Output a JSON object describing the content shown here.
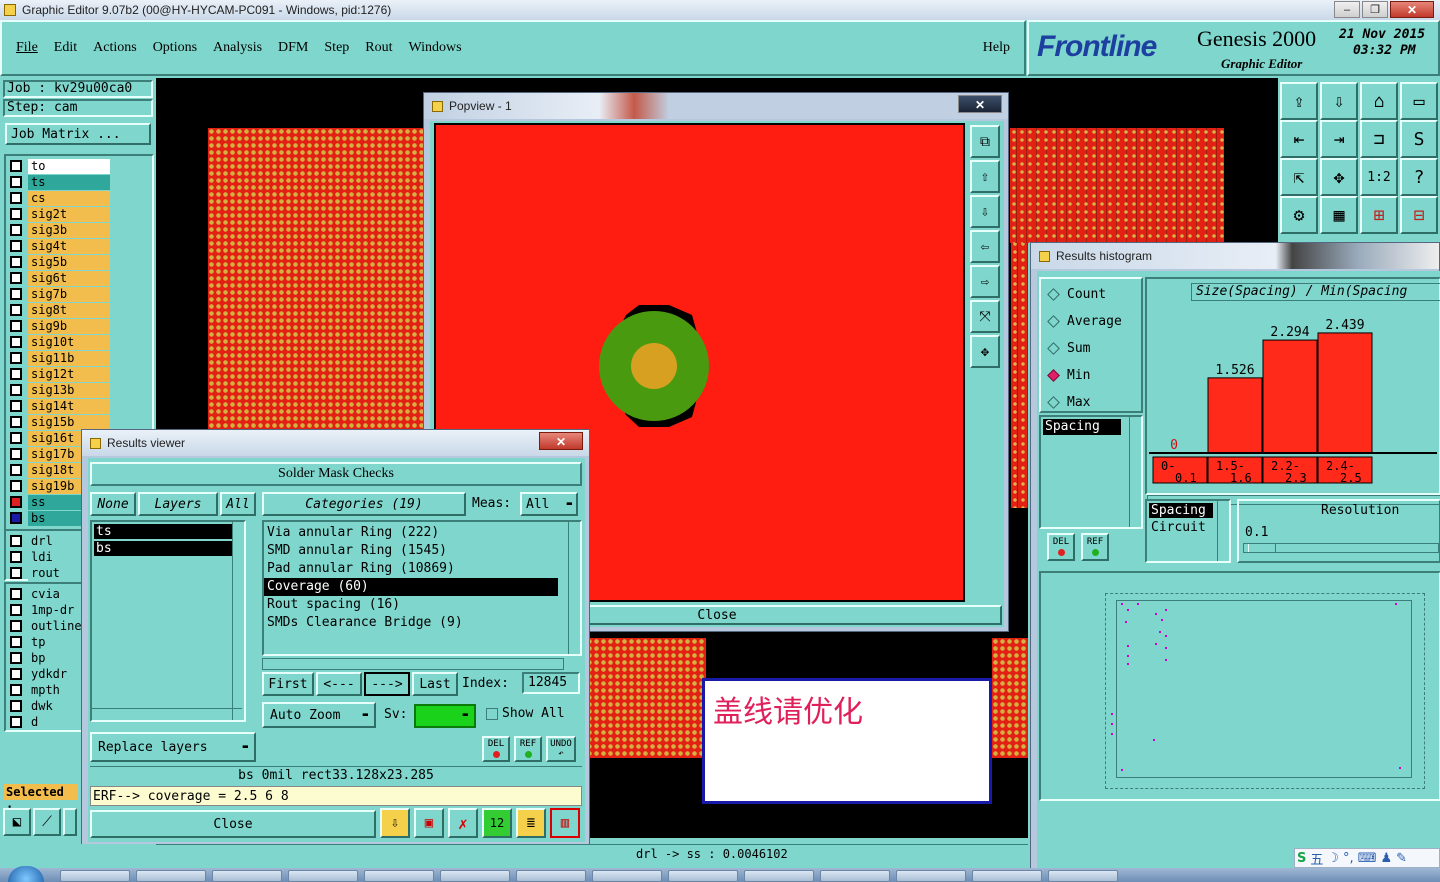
{
  "window": {
    "title": "Graphic Editor 9.07b2 (00@HY-HYCAM-PC091 - Windows, pid:1276)",
    "controls": [
      "–",
      "❐",
      "✕"
    ]
  },
  "menu": {
    "items": [
      "File",
      "Edit",
      "Actions",
      "Options",
      "Analysis",
      "DFM",
      "Step",
      "Rout",
      "Windows"
    ],
    "help": "Help"
  },
  "brand": {
    "logo": "Frontline",
    "product": "Genesis 2000",
    "subtitle": "Graphic Editor",
    "date": "21 Nov 2015",
    "time": "03:32 PM"
  },
  "job": {
    "job_label": "Job  : kv29u00ca0",
    "step_label": "Step: cam",
    "matrix_button": "Job Matrix ..."
  },
  "layers": [
    {
      "name": "to",
      "bg": "#ffffff"
    },
    {
      "name": "ts",
      "bg": "#2fa79a"
    },
    {
      "name": "cs",
      "bg": "#f2bd4c"
    },
    {
      "name": "sig2t",
      "bg": "#f2bd4c"
    },
    {
      "name": "sig3b",
      "bg": "#f2bd4c"
    },
    {
      "name": "sig4t",
      "bg": "#f2bd4c"
    },
    {
      "name": "sig5b",
      "bg": "#f2bd4c"
    },
    {
      "name": "sig6t",
      "bg": "#f2bd4c"
    },
    {
      "name": "sig7b",
      "bg": "#f2bd4c"
    },
    {
      "name": "sig8t",
      "bg": "#f2bd4c"
    },
    {
      "name": "sig9b",
      "bg": "#f2bd4c"
    },
    {
      "name": "sig10t",
      "bg": "#f2bd4c"
    },
    {
      "name": "sig11b",
      "bg": "#f2bd4c"
    },
    {
      "name": "sig12t",
      "bg": "#f2bd4c"
    },
    {
      "name": "sig13b",
      "bg": "#f2bd4c"
    },
    {
      "name": "sig14t",
      "bg": "#f2bd4c"
    },
    {
      "name": "sig15b",
      "bg": "#f2bd4c"
    },
    {
      "name": "sig16t",
      "bg": "#f2bd4c"
    },
    {
      "name": "sig17b",
      "bg": "#f2bd4c"
    },
    {
      "name": "sig18t",
      "bg": "#f2bd4c"
    },
    {
      "name": "sig19b",
      "bg": "#f2bd4c"
    },
    {
      "name": "ss",
      "bg": "#2fa79a"
    },
    {
      "name": "bs",
      "bg": "#2fa79a"
    }
  ],
  "layers2": [
    "drl",
    "ldi",
    "rout"
  ],
  "layers3": [
    "cvia",
    "1mp-dr",
    "outline",
    "tp",
    "bp",
    "ydkdr",
    "mpth",
    "dwk",
    "d"
  ],
  "selected_label": "Selected :",
  "popview": {
    "title": "Popview - 1",
    "close": "Close"
  },
  "results_viewer": {
    "title": "Results viewer",
    "header": "Solder Mask Checks",
    "none": "None",
    "layers": "Layers",
    "all": "All",
    "categories": "Categories (19)",
    "meas_label": "Meas:",
    "meas_value": "All",
    "layer_list": [
      "ts",
      "bs"
    ],
    "categories_list": [
      "Via annular Ring (222)",
      "SMD annular Ring (1545)",
      "Pad annular Ring (10869)",
      "Coverage (60)",
      "Rout spacing (16)",
      "SMDs Clearance Bridge (9)"
    ],
    "selected_category": "Coverage (60)",
    "first": "First",
    "prev": "<---",
    "next": "--->",
    "last": "Last",
    "index_label": "Index:",
    "index_value": "12845",
    "auto_zoom": "Auto Zoom",
    "sv_label": "Sv:",
    "show_all": "Show All",
    "del": "DEL",
    "ref": "REF",
    "undo": "UNDO",
    "replace_layers": "Replace layers",
    "status1": "bs 0mil   rect33.128x23.285",
    "status2": "ERF--> coverage = 2.5 6 8",
    "close": "Close"
  },
  "histogram": {
    "title": "Results histogram",
    "options": [
      "Count",
      "Average",
      "Sum",
      "Min",
      "Max"
    ],
    "selected_option": "Min",
    "list_item": "Spacing",
    "del": "DEL",
    "ref": "REF",
    "chart_title": "Size(Spacing) / Min(Spacing",
    "spacing_label": "Spacing",
    "circuit_label": "Circuit",
    "resolution_label": "Resolution",
    "resolution_value": "0.1"
  },
  "chart_data": {
    "type": "bar",
    "categories": [
      "0-\n0.1",
      "1.5-\n1.6",
      "2.2-\n2.3",
      "2.4-\n2.5"
    ],
    "category_labels_top": [
      "0-",
      "1.5-",
      "2.2-",
      "2.4-"
    ],
    "category_labels_bottom": [
      "0.1",
      "1.6",
      "2.3",
      "2.5"
    ],
    "values": [
      0,
      1.526,
      2.294,
      2.439
    ],
    "value_labels": [
      "0",
      "1.526",
      "2.294",
      "2.439"
    ],
    "title": "Size(Spacing) / Min(Spacing",
    "bar_color": "#ff2a1a"
  },
  "sticky_note": "盖线请优化",
  "status_bar": "drl -> ss : 0.0046102",
  "colors": {
    "teal": "#7fd6cc",
    "pcb_red": "#e22014",
    "pad_green": "#4a9a10",
    "pad_gold": "#d8a020",
    "layer_orange": "#f2bd4c"
  }
}
